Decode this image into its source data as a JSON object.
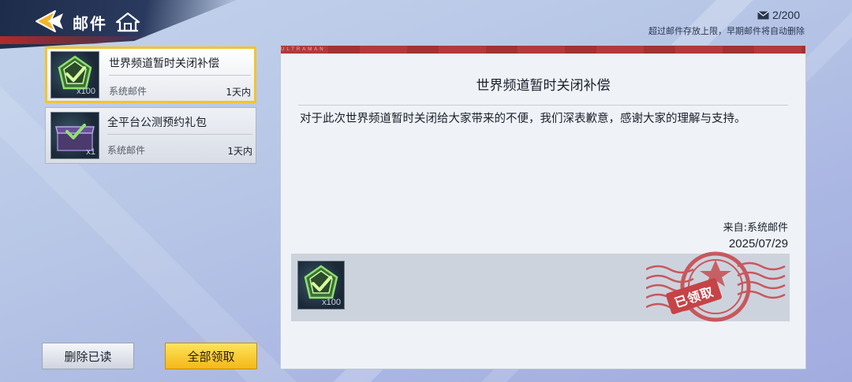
{
  "header": {
    "title": "邮件",
    "back_icon": "back-arrow-icon",
    "home_icon": "home-icon"
  },
  "mail_status": {
    "count": "2/200",
    "notice": "超过邮件存放上限，早期邮件将自动删除"
  },
  "mail_list": [
    {
      "subject": "世界频道暂时关闭补偿",
      "sender": "系统邮件",
      "age": "1天内",
      "thumb_qty": "x100",
      "selected": true
    },
    {
      "subject": "全平台公测预约礼包",
      "sender": "系统邮件",
      "age": "1天内",
      "thumb_qty": "x1",
      "selected": false
    }
  ],
  "buttons": {
    "delete_read": "删除已读",
    "claim_all": "全部领取"
  },
  "detail": {
    "ribbon_text": "ULTRAMAN",
    "title": "世界频道暂时关闭补偿",
    "body": "对于此次世界频道暂时关闭给大家带来的不便，我们深表歉意，感谢大家的理解与支持。",
    "from": "来自:系统邮件",
    "date": "2025/07/29",
    "attachment_qty": "x100",
    "stamp_text": "已领取"
  },
  "colors": {
    "accent_yellow": "#f1c52e",
    "stamp_red": "#c64347",
    "header_navy": "#1e2c4a"
  }
}
